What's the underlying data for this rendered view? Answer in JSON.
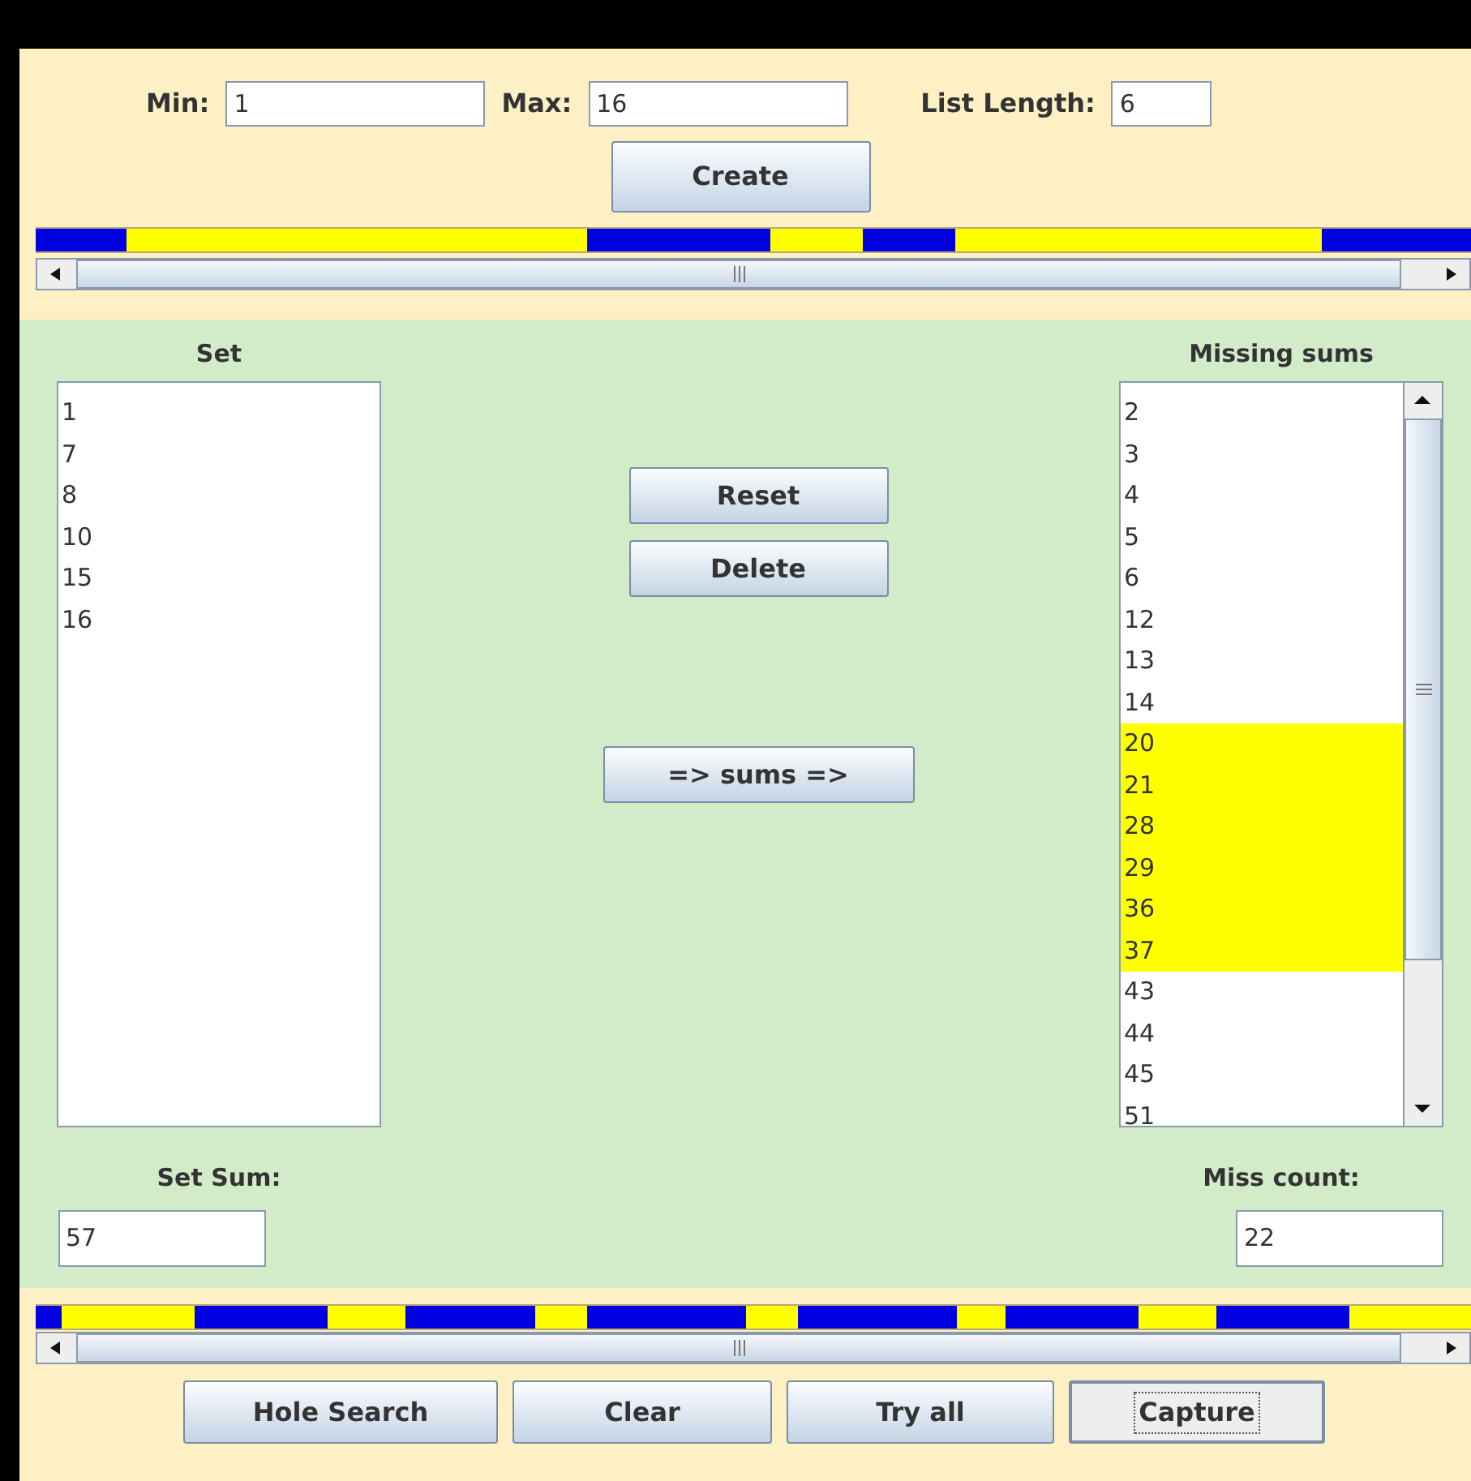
{
  "params": [
    {
      "label": "Min:",
      "value": "1"
    },
    {
      "label": "Max:",
      "value": "16"
    },
    {
      "label": "List Length:",
      "value": "6"
    }
  ],
  "create_button": "Create",
  "set": {
    "title": "Set",
    "items": [
      "1",
      "7",
      "8",
      "10",
      "15",
      "16"
    ]
  },
  "actions": [
    "Reset",
    "Delete"
  ],
  "sums_button": "=> sums =>",
  "missing": {
    "title": "Missing sums",
    "items": [
      {
        "text": "2",
        "selected": false
      },
      {
        "text": "3",
        "selected": false
      },
      {
        "text": "4",
        "selected": false
      },
      {
        "text": "5",
        "selected": false
      },
      {
        "text": "6",
        "selected": false
      },
      {
        "text": "12",
        "selected": false
      },
      {
        "text": "13",
        "selected": false
      },
      {
        "text": "14",
        "selected": false
      },
      {
        "text": "20",
        "selected": true
      },
      {
        "text": "21",
        "selected": true
      },
      {
        "text": "28",
        "selected": true
      },
      {
        "text": "29",
        "selected": true
      },
      {
        "text": "36",
        "selected": true
      },
      {
        "text": "37",
        "selected": true
      },
      {
        "text": "43",
        "selected": false
      },
      {
        "text": "44",
        "selected": false
      },
      {
        "text": "45",
        "selected": false
      },
      {
        "text": "51",
        "selected": false
      }
    ]
  },
  "set_sum": {
    "label": "Set Sum:",
    "value": "57"
  },
  "miss_count": {
    "label": "Miss count:",
    "value": "22"
  },
  "bottom_buttons": [
    {
      "label": "Hole Search",
      "focused": false
    },
    {
      "label": "Clear",
      "focused": false
    },
    {
      "label": "Try all",
      "focused": false
    },
    {
      "label": "Capture",
      "focused": true
    }
  ]
}
